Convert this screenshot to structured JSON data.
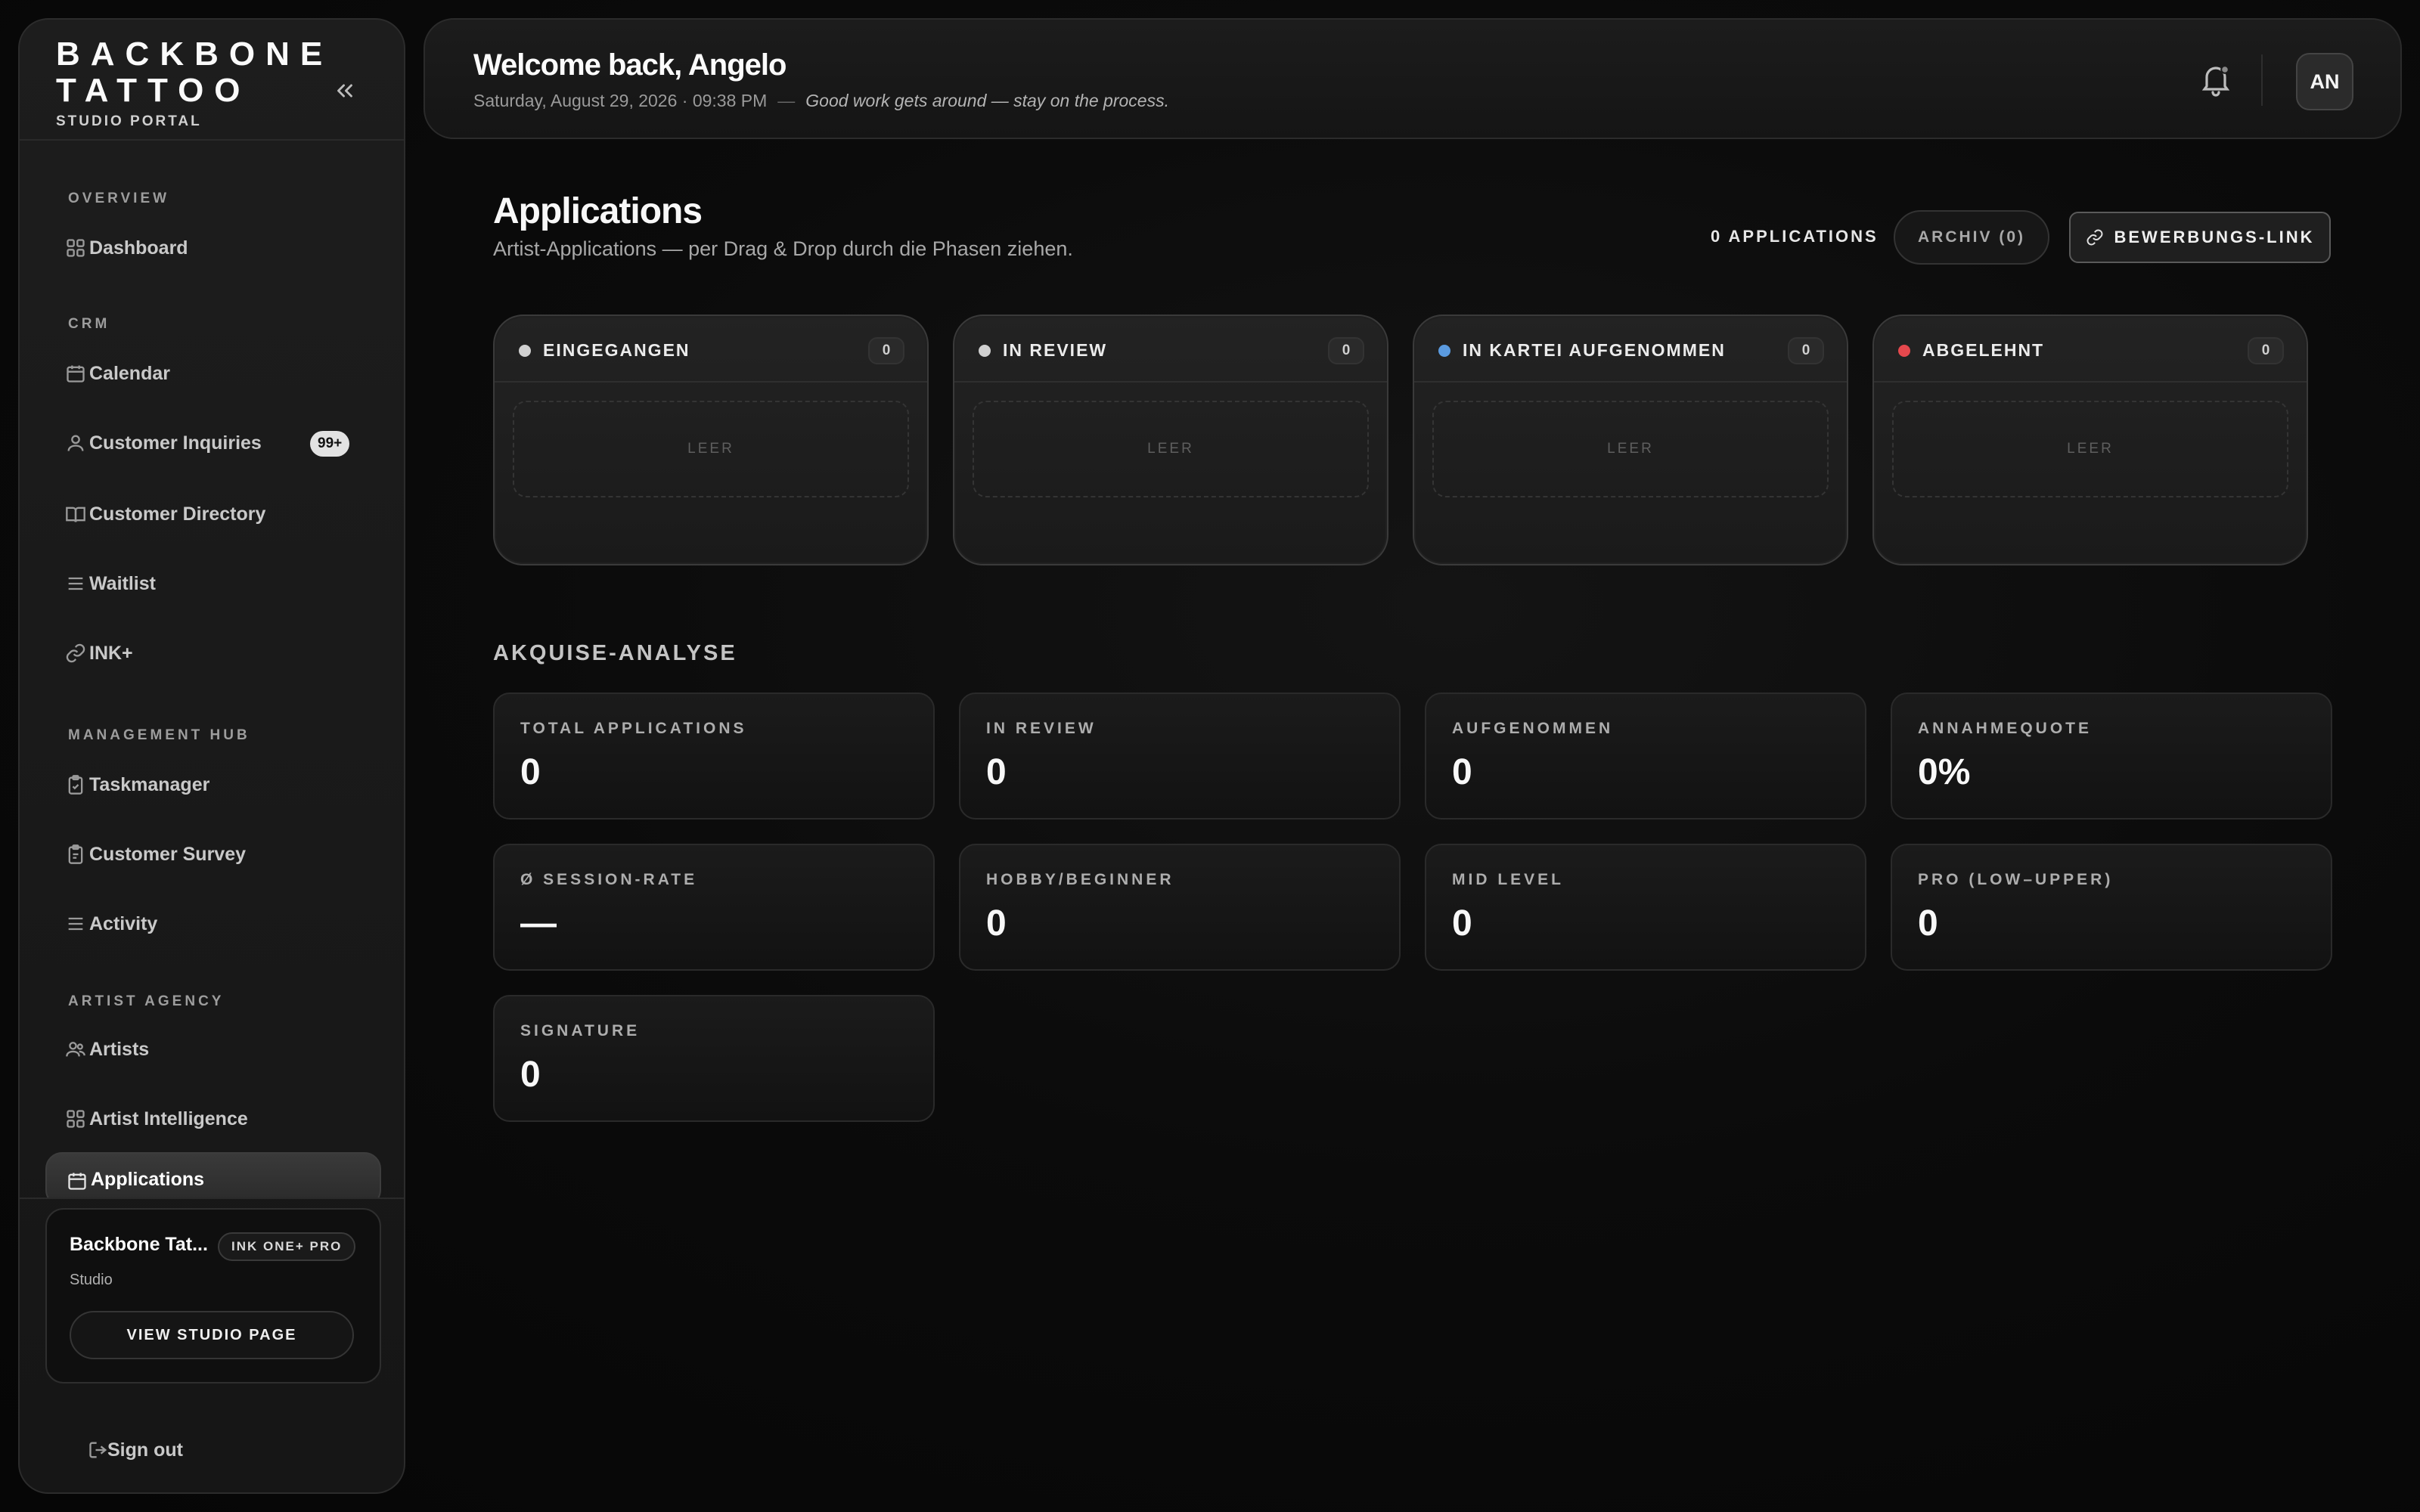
{
  "brand": {
    "line1": "BACKBONE",
    "line2": "TATTOO",
    "sub": "STUDIO PORTAL"
  },
  "sidebar": {
    "sections": [
      {
        "label": "OVERVIEW"
      },
      {
        "label": "CRM"
      },
      {
        "label": "MANAGEMENT HUB"
      },
      {
        "label": "ARTIST AGENCY"
      }
    ],
    "items": [
      {
        "label": "Dashboard",
        "icon": "grid-icon"
      },
      {
        "label": "Calendar",
        "icon": "calendar-icon"
      },
      {
        "label": "Customer Inquiries",
        "icon": "user-icon",
        "badge": "99+"
      },
      {
        "label": "Customer Directory",
        "icon": "book-icon"
      },
      {
        "label": "Waitlist",
        "icon": "list-icon"
      },
      {
        "label": "INK+",
        "icon": "link-icon"
      },
      {
        "label": "Taskmanager",
        "icon": "clipboard-check-icon"
      },
      {
        "label": "Customer Survey",
        "icon": "clipboard-icon"
      },
      {
        "label": "Activity",
        "icon": "list-icon"
      },
      {
        "label": "Artists",
        "icon": "users-icon"
      },
      {
        "label": "Artist Intelligence",
        "icon": "grid-icon"
      },
      {
        "label": "Applications",
        "icon": "calendar-icon",
        "active": true
      }
    ],
    "studio": {
      "name": "Backbone Tat...",
      "plan": "INK ONE+ PRO",
      "type": "Studio",
      "button": "VIEW STUDIO PAGE"
    },
    "signout": "Sign out"
  },
  "header": {
    "welcome": "Welcome back, Angelo",
    "datetime": "Saturday, August 29, 2026 · 09:38 PM",
    "separator": "—",
    "quote": "Good work gets around — stay on the process.",
    "avatar": "AN"
  },
  "page": {
    "title": "Applications",
    "subtitle": "Artist-Applications — per Drag & Drop durch die Phasen ziehen.",
    "count": "0 APPLICATIONS",
    "archiv": "ARCHIV (0)",
    "link_button": "BEWERBUNGS-LINK"
  },
  "columns": [
    {
      "title": "EINGEGANGEN",
      "count": "0",
      "empty": "LEER",
      "dot": "#d0d0d0"
    },
    {
      "title": "IN REVIEW",
      "count": "0",
      "empty": "LEER",
      "dot": "#d0d0d0"
    },
    {
      "title": "IN KARTEI AUFGENOMMEN",
      "count": "0",
      "empty": "LEER",
      "dot": "#5b9be0"
    },
    {
      "title": "ABGELEHNT",
      "count": "0",
      "empty": "LEER",
      "dot": "#e5484d"
    }
  ],
  "analysis": {
    "title": "AKQUISE-ANALYSE",
    "stats": [
      {
        "label": "TOTAL APPLICATIONS",
        "value": "0"
      },
      {
        "label": "IN REVIEW",
        "value": "0"
      },
      {
        "label": "AUFGENOMMEN",
        "value": "0"
      },
      {
        "label": "ANNAHMEQUOTE",
        "value": "0%"
      },
      {
        "label": "Ø SESSION-RATE",
        "value": "—"
      },
      {
        "label": "HOBBY/BEGINNER",
        "value": "0"
      },
      {
        "label": "MID LEVEL",
        "value": "0"
      },
      {
        "label": "PRO (LOW–UPPER)",
        "value": "0"
      },
      {
        "label": "SIGNATURE",
        "value": "0"
      }
    ]
  }
}
